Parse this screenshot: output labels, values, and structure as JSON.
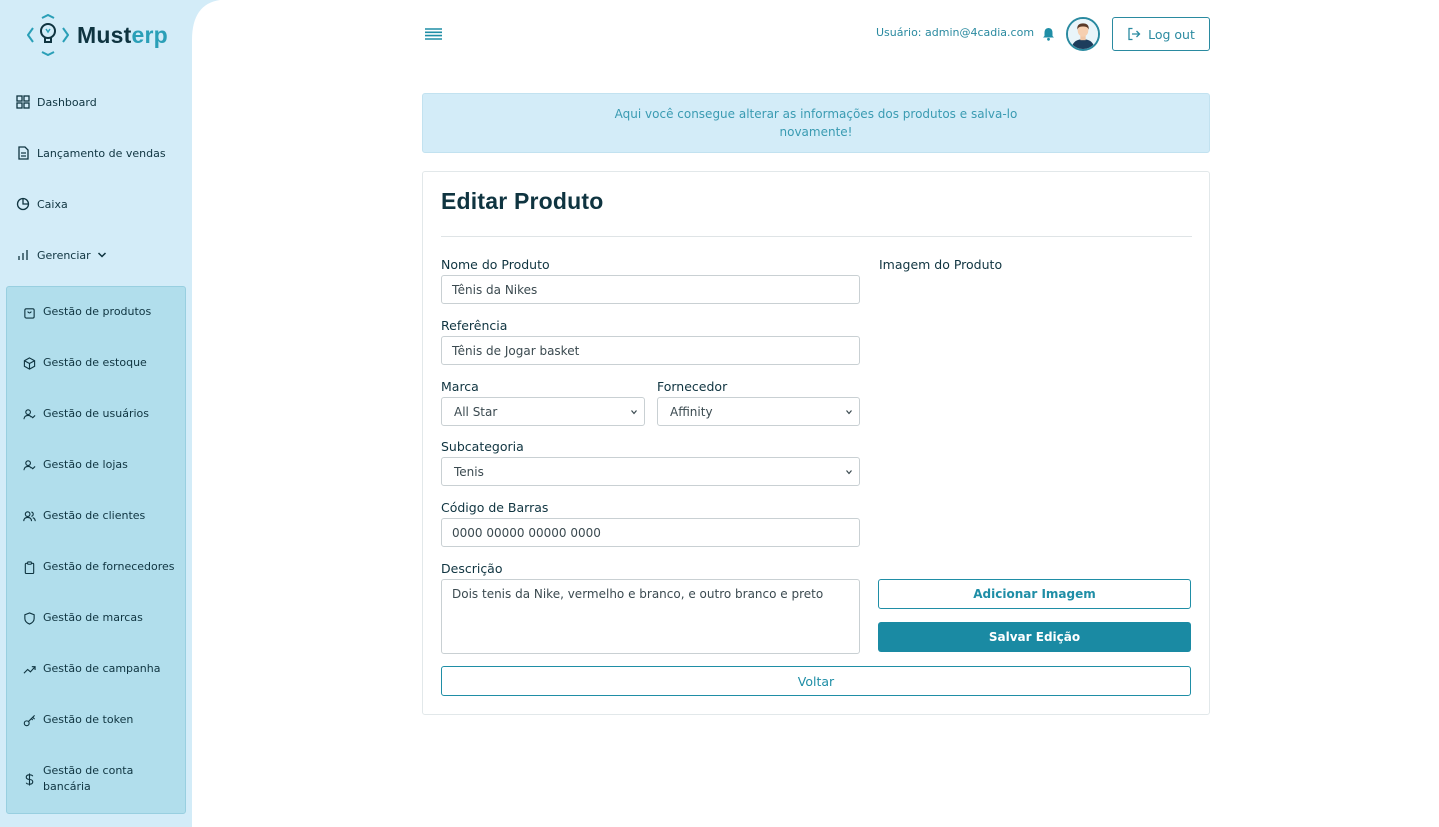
{
  "brand": {
    "name_part1": "Must",
    "name_part2": "erp",
    "accent": "#2a9fb7",
    "dark": "#0f3440"
  },
  "sidebar": {
    "items": [
      {
        "label": "Dashboard",
        "icon": "grid-icon"
      },
      {
        "label": "Lançamento de vendas",
        "icon": "document-icon"
      },
      {
        "label": "Caixa",
        "icon": "pie-chart-icon"
      },
      {
        "label": "Gerenciar",
        "icon": "bar-chart-icon",
        "expanded": true
      }
    ],
    "submenu": [
      {
        "label": "Gestão de produtos",
        "icon": "shopping-bag-icon"
      },
      {
        "label": "Gestão de estoque",
        "icon": "box-icon"
      },
      {
        "label": "Gestão de usuários",
        "icon": "user-check-icon"
      },
      {
        "label": "Gestão de lojas",
        "icon": "user-check-icon"
      },
      {
        "label": "Gestão de clientes",
        "icon": "users-icon"
      },
      {
        "label": "Gestão de fornecedores",
        "icon": "clipboard-icon"
      },
      {
        "label": "Gestão de marcas",
        "icon": "shield-icon"
      },
      {
        "label": "Gestão de campanha",
        "icon": "trending-up-icon"
      },
      {
        "label": "Gestão de token",
        "icon": "key-icon"
      },
      {
        "label": "Gestão de conta bancária",
        "icon": "dollar-icon"
      }
    ]
  },
  "header": {
    "user_label": "Usuário: admin@4cadia.com",
    "logout_label": "Log out"
  },
  "banner": {
    "text": "Aqui você consegue alterar as informações dos produtos e salva-lo novamente!"
  },
  "form": {
    "title": "Editar Produto",
    "product_name": {
      "label": "Nome do Produto",
      "value": "Tênis da Nikes"
    },
    "reference": {
      "label": "Referência",
      "value": "Tênis de Jogar basket"
    },
    "brand": {
      "label": "Marca",
      "selected": "All Star"
    },
    "supplier": {
      "label": "Fornecedor",
      "selected": "Affinity"
    },
    "subcategory": {
      "label": "Subcategoria",
      "selected": "Tenis"
    },
    "barcode": {
      "label": "Código de Barras",
      "value": "0000 00000 00000 0000"
    },
    "description": {
      "label": "Descrição",
      "value": "Dois tenis da Nike, vermelho e branco, e outro branco e preto"
    },
    "image_label": "Imagem do Produto",
    "add_image_label": "Adicionar Imagem",
    "save_label": "Salvar Edição",
    "back_label": "Voltar"
  }
}
